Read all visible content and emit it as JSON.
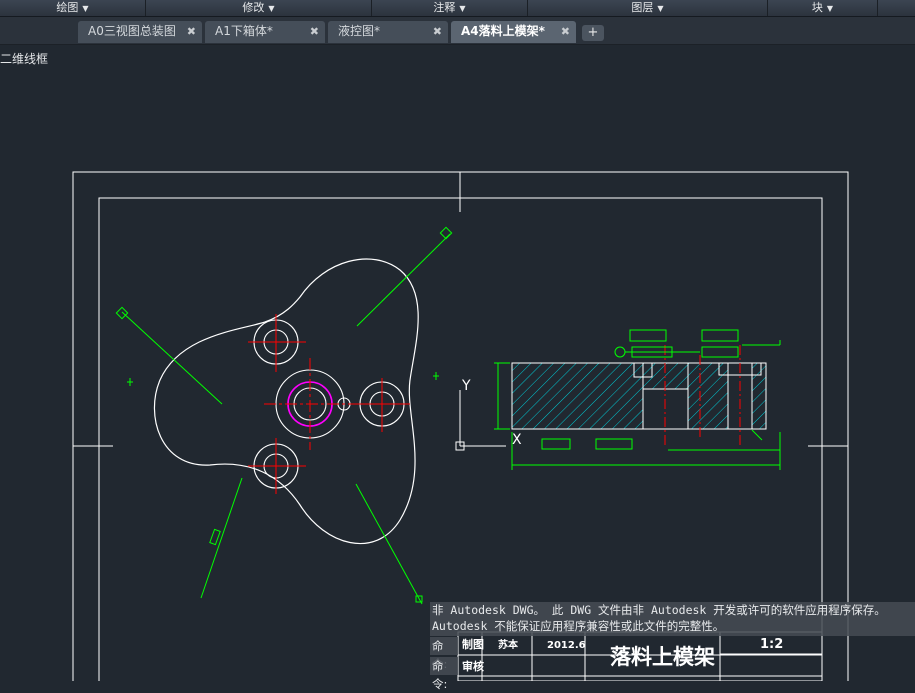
{
  "ribbon": {
    "panels": [
      {
        "label": "绘图"
      },
      {
        "label": "修改"
      },
      {
        "label": "注释"
      },
      {
        "label": "图层"
      },
      {
        "label": "块"
      }
    ]
  },
  "tabs": [
    {
      "label": "A0三视图总装图",
      "active": false
    },
    {
      "label": "A1下箱体*",
      "active": false
    },
    {
      "label": "液控图*",
      "active": false
    },
    {
      "label": "A4落料上模架*",
      "active": true
    }
  ],
  "viewport": {
    "label": "二维线框"
  },
  "messages": {
    "line1": "非 Autodesk DWG。  此 DWG 文件由非 Autodesk 开发或许可的软件应用程序保存。",
    "line2": "Autodesk 不能保证应用程序兼容性或此文件的完整性。"
  },
  "command": {
    "prompt": "命令:"
  },
  "ucs": {
    "y_label": "Y",
    "x_label": "X"
  },
  "title_block": {
    "drawn_label": "制图",
    "name": "苏本",
    "date": "2012.6",
    "check_label": "审核",
    "title": "落料上模架",
    "scale": "1:2"
  },
  "colors": {
    "background": "#212830",
    "geometry": "#ffffff",
    "dimension": "#00ff00",
    "centerline": "#ff0000",
    "hatch": "#00c8d2",
    "highlight": "#ff00ff"
  }
}
